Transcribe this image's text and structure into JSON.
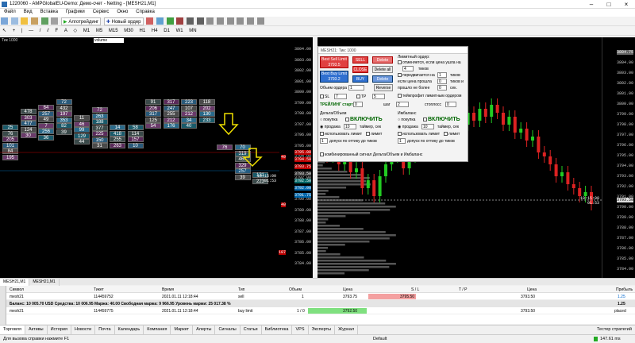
{
  "window": {
    "title": "1220060 - AMPGlobalEU-Demo: Демо-счет - Netting - [MESH21,M1]"
  },
  "menu": [
    "Файл",
    "Вид",
    "Вставка",
    "Графики",
    "Сервис",
    "Окно",
    "Справка"
  ],
  "toolbar": {
    "algo": "Алготрейдинг",
    "new_order": "Новый ордер",
    "sym_label": "Тик 1000",
    "volume_sel": "volume"
  },
  "left_chart": {
    "prices": [
      "3804.00",
      "3803.00",
      "3802.00",
      "3801.00",
      "3800.00",
      "3799.00",
      "3798.00",
      "3797.00",
      "3796.00",
      "3795.00",
      "3794.00",
      "3793.00",
      "3792.00",
      "3791.00",
      "3790.00",
      "3789.00",
      "3788.00",
      "3787.00",
      "3786.00",
      "3785.00",
      "3784.00"
    ],
    "columns": [
      {
        "cells": [
          "25",
          "76",
          "205",
          "101",
          "84",
          "195"
        ]
      },
      {
        "cells": [
          "478",
          "303",
          "477",
          "124",
          "30"
        ]
      },
      {
        "cells": [
          "64",
          "257",
          "49",
          "7",
          "256",
          "36"
        ]
      },
      {
        "cells": [
          "72",
          "432",
          "197",
          "353",
          "82",
          "39"
        ]
      },
      {
        "cells": [
          "11",
          "46",
          "99",
          "129",
          "44"
        ]
      },
      {
        "cells": [
          "72",
          "263",
          "188",
          "377",
          "225",
          "150",
          "31"
        ]
      },
      {
        "cells": [
          "14",
          "418",
          "255",
          "263"
        ]
      },
      {
        "cells": [
          "58",
          "114",
          "157",
          "10"
        ]
      },
      {
        "cells": [
          "91",
          "206",
          "317",
          "125",
          "54"
        ]
      },
      {
        "cells": [
          "317",
          "247",
          "255",
          "212",
          "176"
        ]
      },
      {
        "cells": [
          "223",
          "107",
          "212",
          "34",
          "40"
        ]
      },
      {
        "cells": [
          "118",
          "202",
          "130",
          "233"
        ]
      },
      {
        "cells": [
          "76"
        ]
      },
      {
        "cells": [
          "70",
          "319",
          "467",
          "329",
          "257",
          "39"
        ]
      },
      {
        "cells": [
          "131",
          "223"
        ]
      }
    ],
    "price_tags": [
      "3795.00",
      "3794.50",
      "3793.75",
      "3793.50",
      "3792.50",
      "3792.00",
      "3791.75"
    ],
    "tag_labels": [
      "10:15:00",
      "01:53"
    ],
    "volume_tags": [
      "49",
      "40",
      "107"
    ]
  },
  "right_chart": {
    "prices": [
      "3804.75",
      "3804.00",
      "3803.00",
      "3802.00",
      "3801.00",
      "3800.00",
      "3799.00",
      "3798.00",
      "3797.00",
      "3796.00",
      "3795.00",
      "3794.00",
      "3793.00",
      "3792.00",
      "3791.00",
      "3790.00",
      "3789.00",
      "3788.00",
      "3787.00",
      "3786.00",
      "3785.00",
      "3784.00"
    ],
    "tag_time": "10:15:00",
    "tag_sec": "01:53",
    "tag_price": "3793.50"
  },
  "dialog": {
    "title": "MESH21: Тик: 1000",
    "best_sell": "Best Sell Limit 3793.5",
    "sell": "SELL",
    "delete1": "Delete",
    "close": "CLOSE",
    "delete_all": "Delete all",
    "best_buy": "Best Buy Limit 3793.2",
    "buy": "BUY",
    "delete2": "Delete",
    "volume_label": "Объем ордера",
    "volume_value": "1",
    "reverse": "Reverse",
    "sl_label": "SL",
    "sl_value": "7",
    "tp_label": "TP",
    "tp_value": "5",
    "trailing": "ТРЕЙЛИНГ старт",
    "trail_start": "0",
    "step_label": "шаг",
    "step_value": "2",
    "stoploss_label": "стоплосс",
    "stoploss_value": "0",
    "limit_order": "Лимитный ордер:",
    "cancel_if": "отменяется, если цена ушла на",
    "cancel_ticks": "4",
    "ticks": "тиков",
    "move_if": "передвигается на",
    "move_ticks": "1",
    "ticks2": "тиков",
    "price_passed": "если цена прошла",
    "passed_val": "0",
    "ticks_and": "тиков и",
    "passed_more": "прошло не более",
    "passed_sec": "0",
    "sec": "сек.",
    "market_orders": "тейкпрофит лимитным ордером",
    "delta_title": "Дельта/Объем",
    "imbalance_title": "Имбаланс",
    "buy_opt": "покупка",
    "sell_opt": "продажа",
    "enable": "ВКЛЮЧИТЬ",
    "timer1": "10",
    "timer_label": "таймер, сек",
    "timer2": "10",
    "use_limit": "использовать лимит",
    "limit_word": "лимит",
    "allow": "допуск по оттику до тиков",
    "allow_val1": "1",
    "allow_val2": "1",
    "combined": "комбинированный сигнал Дельта/Объем и Имбаланс"
  },
  "chart_tabs": [
    "MESH21,M1",
    "MESH21,M1"
  ],
  "table": {
    "headers": [
      "Символ",
      "Тикет",
      "Время",
      "Тип",
      "Объем",
      "Цена",
      "S / L",
      "T / P",
      "Цена",
      "Прибыль"
    ],
    "rows": [
      {
        "symbol": "mesh21",
        "ticket": "114459752",
        "time": "2021.01.11 12:18:44",
        "type": "sell",
        "volume": "1",
        "price": "3793.75",
        "sl": "3795.50",
        "tp": "",
        "cur_price": "3793.50",
        "profit": "1.25"
      },
      {
        "symbol": "mesh21",
        "ticket": "114459775",
        "time": "2021.01.11 12:18:44",
        "type": "buy limit",
        "volume": "1 / 0",
        "price": "3792.50",
        "sl": "",
        "tp": "",
        "cur_price": "3793.50",
        "profit": "placed"
      }
    ],
    "balance": "Баланс: 10 005.70 USD  Средства: 10 006.95  Маржа: 40.00  Свободная маржа: 9 966.95  Уровень маржи: 25 017.38 %",
    "balance_profit": "1.25"
  },
  "bottom_tabs": [
    "Торговля",
    "Активы",
    "История",
    "Новости",
    "Почта",
    "Календарь",
    "Компания",
    "Маркет",
    "Алерты",
    "Сигналы",
    "Статьи",
    "Библиотека",
    "VPS",
    "Эксперты",
    "Журнал"
  ],
  "tester": "Тестер стратегий",
  "status": {
    "help": "Для вызова справки нажмите F1",
    "profile": "Default",
    "traffic": "147.61 ms"
  }
}
